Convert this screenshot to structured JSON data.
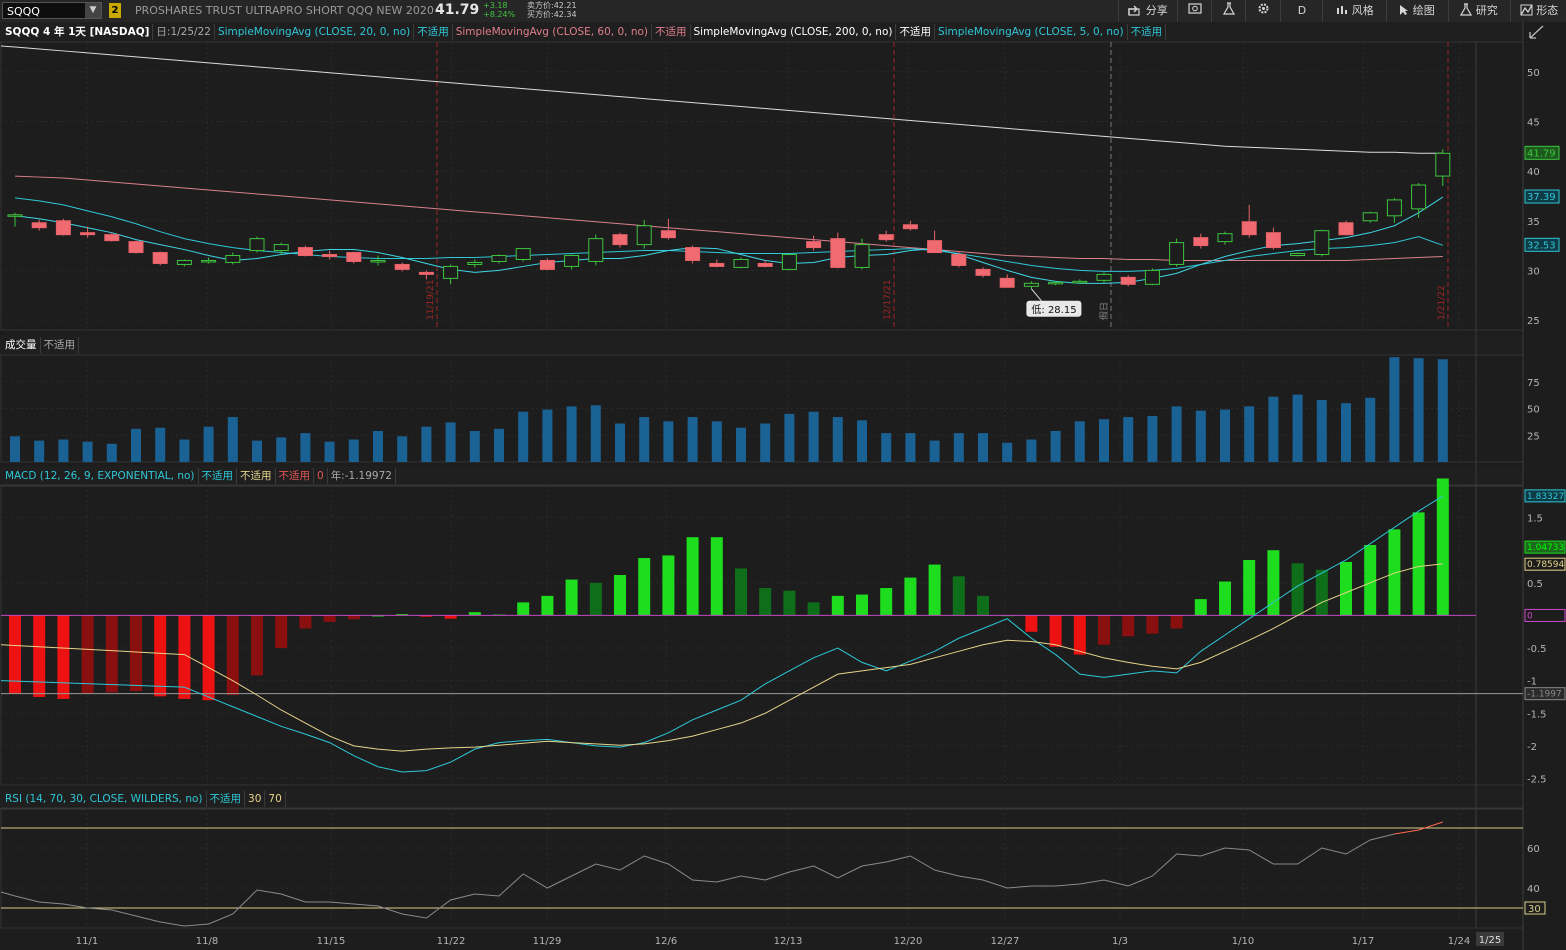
{
  "topbar": {
    "symbol": "SQQQ",
    "link_badge": "2",
    "instrument_name": "PROSHARES TRUST ULTRAPRO SHORT QQQ NEW 2020",
    "last_price": "41.79",
    "change_abs": "+3.18",
    "change_pct": "+8.24%",
    "bid": "卖方价:42.21",
    "ask": "买方价:42.34",
    "share_label": "分享",
    "period_label": "D",
    "style_label": "风格",
    "draw_label": "绘图",
    "studies_label": "研究",
    "pattern_label": "形态"
  },
  "price_panel": {
    "title": "SQQQ 4 年 1天 [NASDAQ]",
    "date": "日:1/25/22",
    "studies": [
      {
        "label": "SimpleMovingAvg (CLOSE, 20, 0, no)",
        "value": "不适用",
        "color": "#2ec8d8"
      },
      {
        "label": "SimpleMovingAvg (CLOSE, 60, 0, no)",
        "value": "不适用",
        "color": "#e07d8e"
      },
      {
        "label": "SimpleMovingAvg (CLOSE, 200, 0, no)",
        "value": "不适用",
        "color": "#ffffff"
      },
      {
        "label": "SimpleMovingAvg (CLOSE, 5, 0, no)",
        "value": "不适用",
        "color": "#2ec8d8"
      }
    ],
    "low_tooltip": "低: 28.15",
    "event_labels": [
      "11/19/21",
      "12/17/21",
      "假日",
      "1/21/22"
    ],
    "y_ticks": [
      "50",
      "45",
      "40",
      "35",
      "30",
      "25"
    ],
    "price_tags": [
      {
        "text": "41.79",
        "color": "#3ec43e"
      },
      {
        "text": "37.39",
        "color": "#2ec8d8"
      },
      {
        "text": "32.53",
        "color": "#2ec8d8"
      }
    ]
  },
  "volume_panel": {
    "title": "成交量",
    "value": "不适用",
    "y_ticks": [
      "75",
      "50",
      "25"
    ]
  },
  "macd_panel": {
    "title": "MACD (12, 26, 9, EXPONENTIAL, no)",
    "values": [
      "不适用",
      "不适用",
      "不适用"
    ],
    "zero": "0",
    "extra": "年:-1.19972",
    "y_ticks": [
      "1.5",
      "0.5",
      "-0.5",
      "-1",
      "-1.5",
      "-2",
      "-2.5"
    ],
    "tags": [
      {
        "text": "1.83327",
        "color": "#2ec8d8"
      },
      {
        "text": "1.04733",
        "color": "#1edc1e"
      },
      {
        "text": "0.78594",
        "color": "#e6d48a"
      },
      {
        "text": "0",
        "color": "#d04ad0"
      },
      {
        "text": "-1.1997",
        "color": "#888888"
      }
    ]
  },
  "rsi_panel": {
    "title": "RSI (14, 70, 30, CLOSE, WILDERS, no)",
    "value": "不适用",
    "oversold": "30",
    "overbought": "70",
    "y_ticks": [
      "60",
      "40"
    ],
    "tag": "30"
  },
  "x_axis": {
    "labels": [
      "11/1",
      "11/8",
      "11/15",
      "11/22",
      "11/29",
      "12/6",
      "12/13",
      "12/20",
      "12/27",
      "1/3",
      "1/10",
      "1/17",
      "1/24"
    ],
    "current": "1/25"
  },
  "chart_data": [
    {
      "type": "candlestick",
      "ylim": [
        24,
        53
      ],
      "candles": [
        {
          "o": 35.5,
          "h": 35.8,
          "l": 34.4,
          "c": 35.6
        },
        {
          "o": 34.8,
          "h": 35.1,
          "l": 34.0,
          "c": 34.3
        },
        {
          "o": 35.0,
          "h": 35.2,
          "l": 33.5,
          "c": 33.6
        },
        {
          "o": 33.8,
          "h": 34.4,
          "l": 33.3,
          "c": 33.6
        },
        {
          "o": 33.6,
          "h": 33.8,
          "l": 32.9,
          "c": 33.0
        },
        {
          "o": 32.9,
          "h": 33.0,
          "l": 31.7,
          "c": 31.8
        },
        {
          "o": 31.8,
          "h": 31.9,
          "l": 30.5,
          "c": 30.7
        },
        {
          "o": 30.6,
          "h": 31.1,
          "l": 30.4,
          "c": 31.0
        },
        {
          "o": 30.9,
          "h": 31.3,
          "l": 30.7,
          "c": 31.0
        },
        {
          "o": 30.8,
          "h": 31.8,
          "l": 30.6,
          "c": 31.5
        },
        {
          "o": 32.0,
          "h": 33.4,
          "l": 31.8,
          "c": 33.2
        },
        {
          "o": 32.0,
          "h": 32.8,
          "l": 31.6,
          "c": 32.6
        },
        {
          "o": 32.3,
          "h": 32.5,
          "l": 31.4,
          "c": 31.5
        },
        {
          "o": 31.6,
          "h": 32.0,
          "l": 31.1,
          "c": 31.4
        },
        {
          "o": 31.8,
          "h": 31.9,
          "l": 30.7,
          "c": 30.9
        },
        {
          "o": 31.0,
          "h": 31.5,
          "l": 30.5,
          "c": 31.0
        },
        {
          "o": 30.6,
          "h": 30.8,
          "l": 29.9,
          "c": 30.1
        },
        {
          "o": 29.8,
          "h": 30.0,
          "l": 29.1,
          "c": 29.6
        },
        {
          "o": 29.2,
          "h": 30.6,
          "l": 28.6,
          "c": 30.4
        },
        {
          "o": 30.6,
          "h": 31.1,
          "l": 30.3,
          "c": 30.8
        },
        {
          "o": 30.9,
          "h": 31.6,
          "l": 30.7,
          "c": 31.5
        },
        {
          "o": 31.1,
          "h": 32.2,
          "l": 30.9,
          "c": 32.2
        },
        {
          "o": 31.0,
          "h": 31.2,
          "l": 30.0,
          "c": 30.1
        },
        {
          "o": 30.4,
          "h": 31.6,
          "l": 30.1,
          "c": 31.5
        },
        {
          "o": 30.9,
          "h": 33.6,
          "l": 30.5,
          "c": 33.2
        },
        {
          "o": 33.6,
          "h": 33.8,
          "l": 32.3,
          "c": 32.6
        },
        {
          "o": 32.6,
          "h": 35.1,
          "l": 32.2,
          "c": 34.5
        },
        {
          "o": 34.0,
          "h": 35.2,
          "l": 33.1,
          "c": 33.3
        },
        {
          "o": 32.3,
          "h": 32.5,
          "l": 30.7,
          "c": 31.0
        },
        {
          "o": 30.7,
          "h": 31.1,
          "l": 30.3,
          "c": 30.4
        },
        {
          "o": 30.3,
          "h": 31.3,
          "l": 30.2,
          "c": 31.1
        },
        {
          "o": 30.7,
          "h": 31.0,
          "l": 30.3,
          "c": 30.4
        },
        {
          "o": 30.1,
          "h": 31.7,
          "l": 30.0,
          "c": 31.6
        },
        {
          "o": 32.9,
          "h": 33.5,
          "l": 32.0,
          "c": 32.3
        },
        {
          "o": 33.2,
          "h": 33.8,
          "l": 30.2,
          "c": 30.3
        },
        {
          "o": 30.3,
          "h": 33.2,
          "l": 30.1,
          "c": 32.6
        },
        {
          "o": 33.6,
          "h": 34.0,
          "l": 32.9,
          "c": 33.1
        },
        {
          "o": 34.6,
          "h": 35.0,
          "l": 34.0,
          "c": 34.2
        },
        {
          "o": 33.0,
          "h": 34.0,
          "l": 31.9,
          "c": 31.8
        },
        {
          "o": 31.6,
          "h": 31.9,
          "l": 30.3,
          "c": 30.5
        },
        {
          "o": 30.1,
          "h": 30.3,
          "l": 29.3,
          "c": 29.5
        },
        {
          "o": 29.2,
          "h": 29.6,
          "l": 28.3,
          "c": 28.3
        },
        {
          "o": 28.4,
          "h": 28.9,
          "l": 28.15,
          "c": 28.7
        },
        {
          "o": 28.7,
          "h": 28.9,
          "l": 28.5,
          "c": 28.8
        },
        {
          "o": 28.8,
          "h": 29.1,
          "l": 28.7,
          "c": 28.9
        },
        {
          "o": 29.0,
          "h": 29.8,
          "l": 28.7,
          "c": 29.6
        },
        {
          "o": 29.3,
          "h": 29.5,
          "l": 28.4,
          "c": 28.6
        },
        {
          "o": 28.6,
          "h": 30.2,
          "l": 28.5,
          "c": 30.0
        },
        {
          "o": 30.6,
          "h": 33.2,
          "l": 30.4,
          "c": 32.8
        },
        {
          "o": 33.3,
          "h": 33.7,
          "l": 32.2,
          "c": 32.5
        },
        {
          "o": 32.9,
          "h": 33.9,
          "l": 32.6,
          "c": 33.7
        },
        {
          "o": 34.9,
          "h": 36.6,
          "l": 33.3,
          "c": 33.6
        },
        {
          "o": 33.8,
          "h": 34.3,
          "l": 32.1,
          "c": 32.3
        },
        {
          "o": 31.5,
          "h": 31.8,
          "l": 31.4,
          "c": 31.7
        },
        {
          "o": 31.6,
          "h": 34.1,
          "l": 31.4,
          "c": 34.0
        },
        {
          "o": 34.8,
          "h": 35.0,
          "l": 33.5,
          "c": 33.6
        },
        {
          "o": 35.0,
          "h": 35.9,
          "l": 34.8,
          "c": 35.8
        },
        {
          "o": 35.5,
          "h": 37.3,
          "l": 34.8,
          "c": 37.1
        },
        {
          "o": 36.2,
          "h": 38.8,
          "l": 35.3,
          "c": 38.6
        },
        {
          "o": 39.5,
          "h": 42.2,
          "l": 38.5,
          "c": 41.79
        }
      ],
      "sma20": [
        37.3,
        37.0,
        36.6,
        36.0,
        35.4,
        34.7,
        33.9,
        33.2,
        32.7,
        32.3,
        32.0,
        31.8,
        31.6,
        31.4,
        31.3,
        31.2,
        31.2,
        31.2,
        31.3,
        31.3,
        31.4,
        31.5,
        31.6,
        31.7,
        31.8,
        31.9,
        32.0,
        32.0,
        31.9,
        31.8,
        31.7,
        31.7,
        31.7,
        31.8,
        31.9,
        32.0,
        32.1,
        32.2,
        32.0,
        31.7,
        31.3,
        30.9,
        30.5,
        30.2,
        30.0,
        29.9,
        29.9,
        30.0,
        30.2,
        30.6,
        31.0,
        31.4,
        31.7,
        32.0,
        32.2,
        32.3,
        32.5,
        32.8,
        33.4,
        32.53
      ],
      "sma5": [
        35.5,
        35.2,
        34.8,
        34.3,
        33.8,
        33.1,
        32.6,
        32.1,
        31.5,
        31.0,
        31.2,
        31.6,
        31.9,
        32.1,
        32.1,
        31.8,
        31.3,
        30.7,
        30.1,
        29.8,
        30.0,
        30.4,
        30.8,
        31.0,
        31.2,
        31.2,
        31.5,
        32.0,
        32.3,
        32.2,
        31.6,
        31.0,
        30.7,
        30.8,
        31.3,
        31.5,
        31.6,
        32.0,
        32.2,
        31.6,
        30.8,
        30.0,
        29.3,
        28.9,
        28.7,
        28.7,
        28.8,
        29.2,
        29.7,
        30.6,
        31.4,
        32.0,
        32.5,
        32.7,
        33.0,
        33.3,
        33.8,
        34.5,
        35.8,
        37.39
      ],
      "sma60": [
        39.5,
        39.4,
        39.3,
        39.1,
        38.9,
        38.7,
        38.5,
        38.3,
        38.1,
        37.9,
        37.7,
        37.5,
        37.3,
        37.1,
        36.9,
        36.7,
        36.5,
        36.3,
        36.1,
        35.9,
        35.7,
        35.5,
        35.3,
        35.1,
        34.9,
        34.7,
        34.5,
        34.3,
        34.1,
        33.9,
        33.7,
        33.5,
        33.3,
        33.1,
        32.9,
        32.7,
        32.5,
        32.3,
        32.1,
        31.9,
        31.7,
        31.5,
        31.4,
        31.3,
        31.2,
        31.2,
        31.1,
        31.1,
        31.0,
        31.0,
        31.0,
        31.0,
        31.0,
        31.0,
        31.0,
        31.0,
        31.1,
        31.2,
        31.3,
        31.4
      ],
      "sma200": [
        52.5,
        52.3,
        52.1,
        51.9,
        51.7,
        51.5,
        51.3,
        51.1,
        50.9,
        50.7,
        50.5,
        50.3,
        50.1,
        49.9,
        49.7,
        49.5,
        49.3,
        49.1,
        48.9,
        48.7,
        48.5,
        48.3,
        48.1,
        47.9,
        47.7,
        47.5,
        47.3,
        47.1,
        46.9,
        46.7,
        46.5,
        46.3,
        46.1,
        45.9,
        45.7,
        45.5,
        45.3,
        45.1,
        44.9,
        44.7,
        44.5,
        44.3,
        44.1,
        43.9,
        43.7,
        43.5,
        43.3,
        43.1,
        42.9,
        42.7,
        42.5,
        42.4,
        42.3,
        42.2,
        42.1,
        42.0,
        41.9,
        41.9,
        41.8,
        41.8
      ]
    },
    {
      "type": "bar",
      "ylim": [
        0,
        100
      ],
      "values": [
        24,
        20,
        21,
        19,
        17,
        31,
        32,
        21,
        33,
        42,
        20,
        23,
        27,
        19,
        21,
        29,
        24,
        33,
        37,
        29,
        31,
        47,
        49,
        52,
        53,
        36,
        42,
        38,
        42,
        38,
        32,
        36,
        45,
        47,
        42,
        39,
        27,
        27,
        20,
        27,
        27,
        18,
        21,
        29,
        38,
        40,
        42,
        43,
        52,
        48,
        49,
        52,
        61,
        63,
        58,
        55,
        60,
        98,
        97,
        96
      ]
    },
    {
      "type": "macd",
      "ylim": [
        -2.6,
        2.0
      ],
      "value": [
        -1.1,
        -1.25,
        -1.4,
        -1.55,
        -1.7,
        -1.82,
        -1.95,
        -2.15,
        -2.32,
        -2.4,
        -2.38,
        -2.25,
        -2.05,
        -1.95,
        -1.92,
        -1.9,
        -1.95,
        -2.0,
        -2.02,
        -1.95,
        -1.8,
        -1.6,
        -1.45,
        -1.3,
        -1.05,
        -0.85,
        -0.65,
        -0.5,
        -0.72,
        -0.85,
        -0.7,
        -0.55,
        -0.35,
        -0.2,
        -0.05,
        -0.35,
        -0.6,
        -0.9,
        -0.95,
        -0.9,
        -0.85,
        -0.88,
        -0.55,
        -0.3,
        -0.05,
        0.2,
        0.45,
        0.65,
        0.85,
        1.1,
        1.35,
        1.6,
        1.83
      ],
      "average": [
        -0.6,
        -0.8,
        -1.0,
        -1.22,
        -1.45,
        -1.65,
        -1.85,
        -2.0,
        -2.05,
        -2.08,
        -2.05,
        -2.03,
        -2.02,
        -1.99,
        -1.96,
        -1.93,
        -1.95,
        -1.97,
        -1.99,
        -1.97,
        -1.92,
        -1.85,
        -1.75,
        -1.65,
        -1.5,
        -1.3,
        -1.1,
        -0.9,
        -0.85,
        -0.8,
        -0.75,
        -0.65,
        -0.55,
        -0.45,
        -0.38,
        -0.4,
        -0.45,
        -0.55,
        -0.65,
        -0.72,
        -0.78,
        -0.82,
        -0.72,
        -0.55,
        -0.38,
        -0.2,
        0.0,
        0.2,
        0.35,
        0.5,
        0.65,
        0.75,
        0.79
      ],
      "hist": [
        -1.2,
        -1.25,
        -1.28,
        -1.2,
        -1.18,
        -1.16,
        -1.24,
        -1.28,
        -1.3,
        -1.22,
        -0.92,
        -0.5,
        -0.2,
        -0.1,
        -0.06,
        0,
        0.02,
        -0.02,
        -0.05,
        0.05,
        0.02,
        0.2,
        0.3,
        0.55,
        0.5,
        0.62,
        0.88,
        0.92,
        1.2,
        1.2,
        0.72,
        0.42,
        0.38,
        0.2,
        0.3,
        0.32,
        0.42,
        0.58,
        0.78,
        0.6,
        0.3,
        0,
        -0.25,
        -0.48,
        -0.6,
        -0.45,
        -0.32,
        -0.28,
        -0.2,
        0.25,
        0.52,
        0.85,
        1.0,
        0.8,
        0.7,
        0.82,
        1.08,
        1.32,
        1.58,
        2.1
      ]
    },
    {
      "type": "line",
      "ylim": [
        20,
        80
      ],
      "rsi": [
        36,
        33,
        32,
        30,
        29,
        26,
        23,
        21,
        22,
        27,
        39,
        37,
        33,
        33,
        32,
        31,
        27,
        25,
        34,
        37,
        36,
        47,
        40,
        46,
        52,
        49,
        56,
        52,
        44,
        43,
        46,
        44,
        48,
        51,
        45,
        51,
        53,
        56,
        49,
        46,
        44,
        40,
        41,
        41,
        42,
        44,
        41,
        46,
        57,
        56,
        60,
        59,
        52,
        52,
        60,
        57,
        64,
        67,
        69,
        73
      ]
    }
  ]
}
